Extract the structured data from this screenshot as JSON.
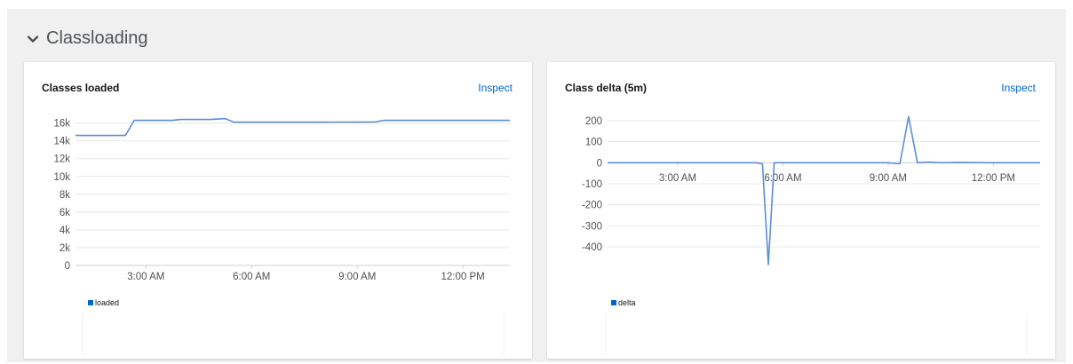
{
  "section": {
    "title": "Classloading",
    "icon": "chevron-down-icon"
  },
  "cards": [
    {
      "title": "Classes loaded",
      "inspect_label": "Inspect",
      "chart_data": {
        "type": "line",
        "title": "Classes loaded",
        "x_ticks": [
          "3:00 AM",
          "6:00 AM",
          "9:00 AM",
          "12:00 PM"
        ],
        "y_ticks": [
          "0",
          "2k",
          "4k",
          "6k",
          "8k",
          "10k",
          "12k",
          "14k",
          "16k"
        ],
        "ylim": [
          0,
          16000
        ],
        "xlim": [
          "1:00 AM",
          "1:20 PM"
        ],
        "series": [
          {
            "name": "loaded",
            "color": "#5b8fd6",
            "x": [
              "1:00 AM",
              "2:25 AM",
              "2:40 AM",
              "3:45 AM",
              "4:00 AM",
              "4:50 AM",
              "5:15 AM",
              "5:30 AM",
              "6:30 AM",
              "8:00 AM",
              "9:00 AM",
              "9:30 AM",
              "9:45 AM",
              "11:00 AM",
              "12:00 PM",
              "1:20 PM"
            ],
            "values": [
              14600,
              14600,
              16300,
              16300,
              16400,
              16400,
              16500,
              16100,
              16100,
              16100,
              16120,
              16120,
              16300,
              16300,
              16300,
              16300
            ]
          }
        ],
        "legend": "bottom-left",
        "grid": true
      }
    },
    {
      "title": "Class delta (5m)",
      "inspect_label": "Inspect",
      "chart_data": {
        "type": "line",
        "title": "Class delta (5m)",
        "x_ticks": [
          "3:00 AM",
          "6:00 AM",
          "9:00 AM",
          "12:00 PM"
        ],
        "y_ticks": [
          "200",
          "100",
          "0",
          "-100",
          "-200",
          "-300",
          "-400"
        ],
        "ylim": [
          -480,
          240
        ],
        "xlim": [
          "1:00 AM",
          "1:20 PM"
        ],
        "series": [
          {
            "name": "delta",
            "color": "#5b8fd6",
            "x": [
              "1:00 AM",
              "4:00 AM",
              "5:15 AM",
              "5:25 AM",
              "5:35 AM",
              "5:45 AM",
              "9:00 AM",
              "9:20 AM",
              "9:35 AM",
              "9:50 AM",
              "10:10 AM",
              "10:30 AM",
              "11:00 AM",
              "12:00 PM",
              "1:20 PM"
            ],
            "values": [
              0,
              0,
              0,
              -5,
              -485,
              0,
              0,
              -5,
              220,
              0,
              3,
              0,
              2,
              0,
              0
            ]
          }
        ],
        "legend": "bottom-left",
        "grid": true
      }
    }
  ]
}
